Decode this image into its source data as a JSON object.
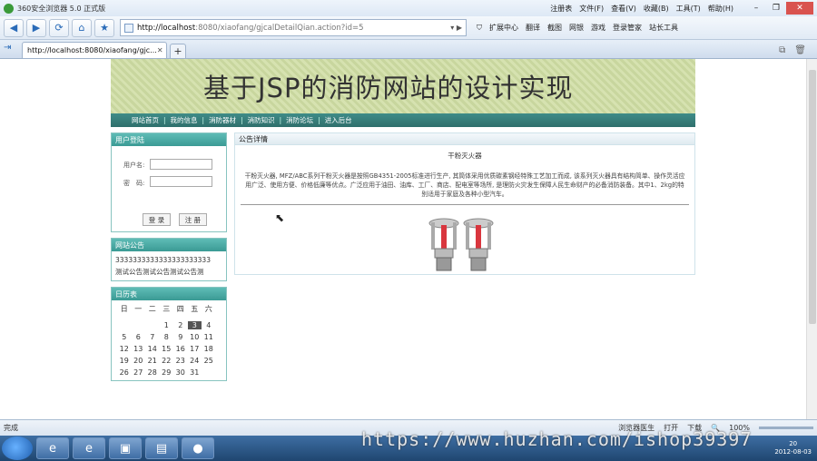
{
  "browser": {
    "title": "360安全浏览器 5.0 正式版",
    "menus": [
      "注册表",
      "文件(F)",
      "查看(V)",
      "收藏(B)",
      "工具(T)",
      "帮助(H)"
    ],
    "address_host": "http://localhost",
    "address_rest": ":8080/xiaofang/gjcalDetailQian.action?id=5",
    "toolbar_items": [
      "扩展中心",
      "翻译",
      "截图",
      "网银",
      "游戏",
      "登录管家",
      "站长工具"
    ],
    "tab_title": "http://localhost:8080/xiaofang/gjc...",
    "status_left": "完成",
    "status_items": [
      "浏览器医生",
      "打开",
      "下载"
    ],
    "zoom": "100%",
    "clock_time": "20",
    "clock_date": "2012-08-03"
  },
  "site": {
    "banner_title": "基于JSP的消防网站的设计实现",
    "menu": [
      "网站首页",
      "我的信息",
      "消防器材",
      "消防知识",
      "消防论坛",
      "进入后台"
    ],
    "login": {
      "title": "用户登陆",
      "username_label": "用户名:",
      "password_label": "密　码:",
      "login_btn": "登 录",
      "register_btn": "注 册"
    },
    "notice": {
      "title": "网站公告",
      "lines": [
        "3333333333333333333333",
        "测试公告测试公告测试公告测"
      ]
    },
    "calendar": {
      "title": "日历表",
      "weekdays": [
        "日",
        "一",
        "二",
        "三",
        "四",
        "五",
        "六"
      ],
      "days": [
        "",
        "",
        "",
        "",
        "",
        "",
        "",
        "",
        "",
        "",
        "1",
        "2",
        "3",
        "4",
        "5",
        "6",
        "7",
        "8",
        "9",
        "10",
        "11",
        "12",
        "13",
        "14",
        "15",
        "16",
        "17",
        "18",
        "19",
        "20",
        "21",
        "22",
        "23",
        "24",
        "25",
        "26",
        "27",
        "28",
        "29",
        "30",
        "31",
        ""
      ],
      "today": "3"
    },
    "detail": {
      "section_title": "公告详情",
      "title": "干粉灭火器",
      "content": "干粉灭火器, MFZ/ABC系列干粉灭火器是按照GB4351-2005标准进行生产, 其筒体采用优质碳素钢经特殊工艺加工而成, 该系列灭火器具有结构简单、操作灵活应用广泛、使用方便、价格低廉等优点。广泛应用于油田、油库、工厂、商店、配电室等场所, 是理防火灾发生保障人民生命财产的必备消防装备。其中1、2kg的特别适用于家庭及各种小型汽车。"
    }
  },
  "watermark": "https://www.huzhan.com/ishop39397"
}
